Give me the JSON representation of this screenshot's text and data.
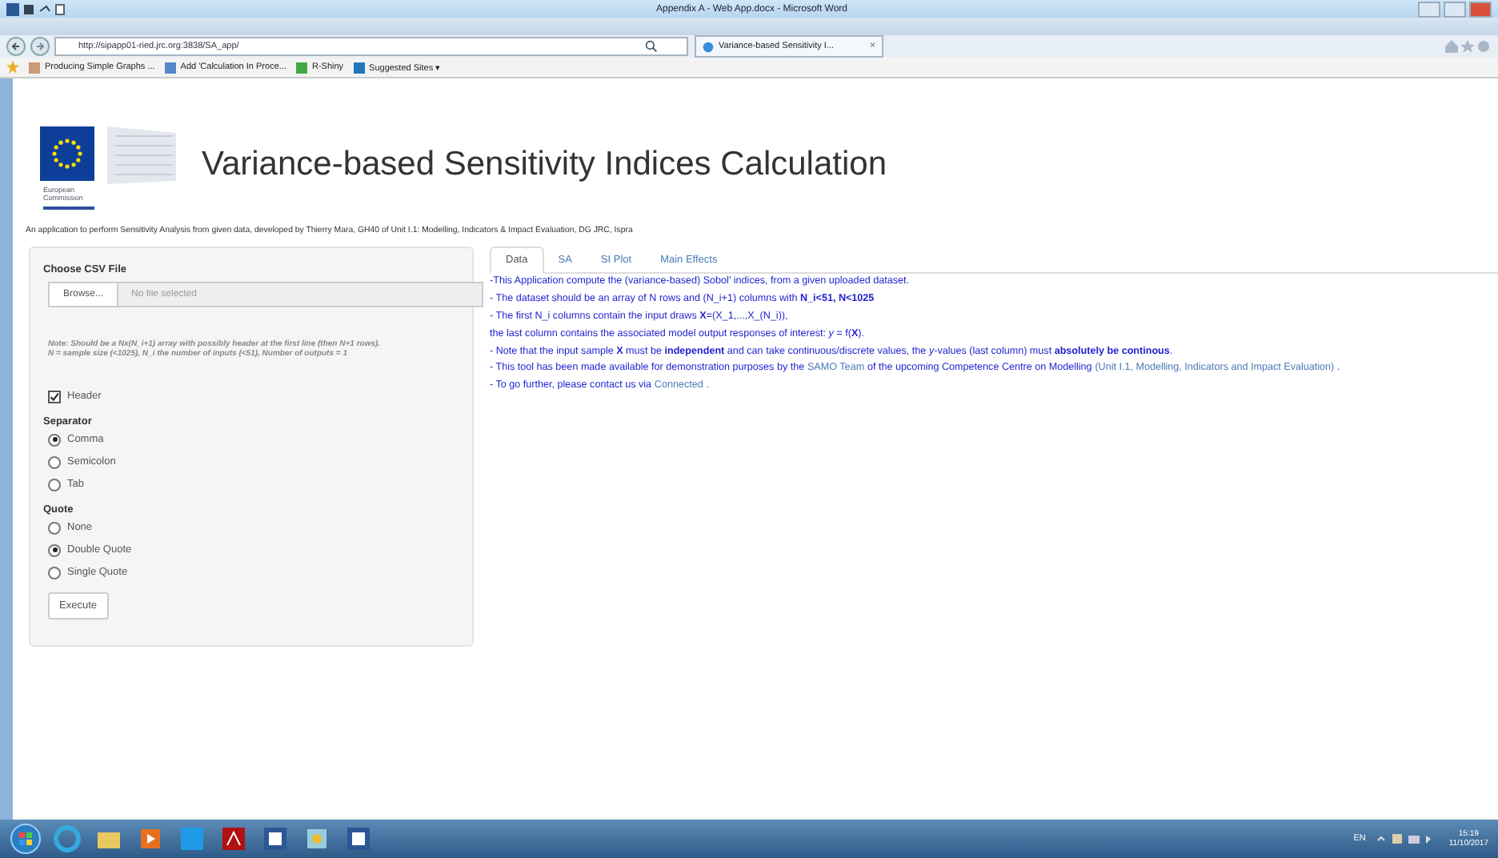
{
  "word_window": {
    "title": "Appendix A - Web App.docx - Microsoft Word"
  },
  "browser": {
    "address": "http://sipapp01-ried.jrc.org:3838/SA_app/",
    "tab": {
      "label": "Variance-based Sensitivity I...",
      "close": "×"
    },
    "favorites": [
      {
        "label": "Producing Simple Graphs ..."
      },
      {
        "label": "Add 'Calculation In Proce..."
      },
      {
        "label": "R-Shiny"
      },
      {
        "label": "Suggested Sites ▾"
      }
    ]
  },
  "page": {
    "logo_caption": [
      "European",
      "Commission"
    ],
    "title": "Variance-based Sensitivity Indices Calculation",
    "subtitle": "An application to perform Sensitivity Analysis from given data, developed by Thierry Mara, GH40 of Unit I.1: Modelling, Indicators & Impact Evaluation, DG JRC, Ispra"
  },
  "sidebar": {
    "file_label": "Choose CSV File",
    "browse": "Browse...",
    "file_placeholder": "No file selected",
    "note": [
      "Note: Should be a Nx(N_i+1) array with possibly header at the first line (then N+1 rows).",
      "N = sample size (<1025), N_i the number of inputs (<51), Number of outputs = 1"
    ],
    "header": {
      "label": "Header",
      "checked": true
    },
    "groups": [
      {
        "label": "Separator",
        "options": [
          {
            "label": "Comma",
            "selected": true
          },
          {
            "label": "Semicolon",
            "selected": false
          },
          {
            "label": "Tab",
            "selected": false
          }
        ]
      },
      {
        "label": "Quote",
        "options": [
          {
            "label": "None",
            "selected": false
          },
          {
            "label": "Double Quote",
            "selected": true
          },
          {
            "label": "Single Quote",
            "selected": false
          }
        ]
      }
    ],
    "execute": "Execute"
  },
  "tabs": [
    {
      "label": "Data",
      "selected": true
    },
    {
      "label": "SA",
      "selected": false
    },
    {
      "label": "SI Plot",
      "selected": false
    },
    {
      "label": "Main Effects",
      "selected": false
    }
  ],
  "paragraphs": [
    [
      {
        "kind": "text",
        "text": "-This Application compute the (variance-based) Sobol' indices, from a given uploaded dataset."
      }
    ],
    [
      {
        "kind": "text",
        "text": "- The dataset should be an array of N rows and (N_i+1) columns with **N_i<51, N<1025**"
      }
    ],
    [
      {
        "kind": "text",
        "text": "- The first N_i columns contain the input draws **X**=(X_1,...,X_(N_i)),"
      }
    ],
    [
      {
        "kind": "text",
        "text": "the last column contains the associated model output responses of interest: *y* = f(**X**)."
      }
    ],
    [
      {
        "kind": "text",
        "text": "- Note that the input sample **X** must be **independent** and can take continuous/discrete values, the *y*-values (last column) must **absolutely be continous**."
      }
    ],
    [
      {
        "kind": "text",
        "text": "- This tool has been made available for demonstration purposes by the"
      },
      {
        "kind": "link",
        "text": "SAMO Team"
      },
      {
        "kind": "text",
        "text": "of the upcoming Competence Centre on Modelling"
      },
      {
        "kind": "link",
        "text": "(Unit I.1, Modelling, Indicators and Impact Evaluation)"
      },
      {
        "kind": "text",
        "text": "."
      }
    ],
    [
      {
        "kind": "text",
        "text": "- To go further, please contact us via"
      },
      {
        "kind": "link",
        "text": "Connected"
      },
      {
        "kind": "text",
        "text": "."
      }
    ]
  ],
  "taskbar": {
    "language": "EN",
    "time": "15:19",
    "date": "11/10/2017"
  }
}
